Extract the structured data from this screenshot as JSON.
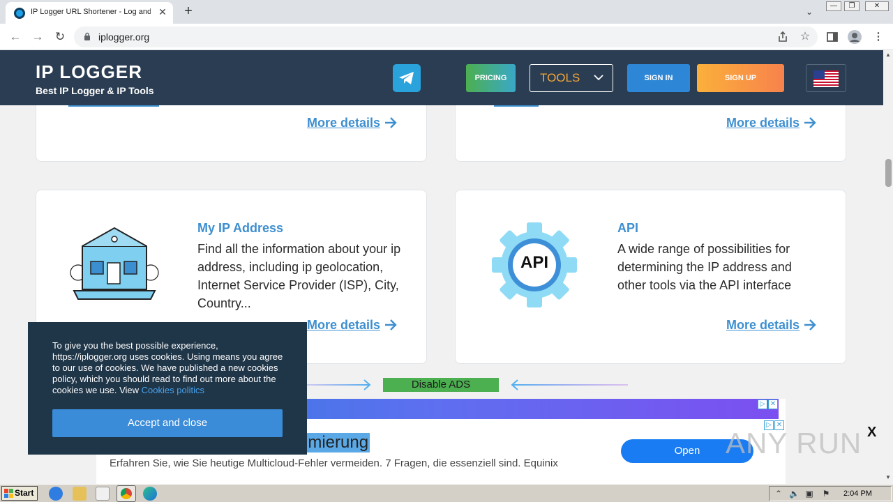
{
  "browser": {
    "tab_title": "IP Logger URL Shortener - Log and T",
    "tab_close": "✕",
    "new_tab": "+",
    "url": "iplogger.org",
    "back": "←",
    "forward": "→",
    "reload": "↻",
    "tab_search": "⌄",
    "window_controls": [
      "—",
      "❐",
      "✕"
    ],
    "menu": "⋮"
  },
  "site": {
    "logo": "IP LOGGER",
    "tagline": "Best IP Logger & IP Tools",
    "nav": {
      "pricing": "PRICING",
      "tools": "TOOLS",
      "sign_in": "SIGN IN",
      "sign_up": "SIGN UP"
    }
  },
  "cards": {
    "top_left": {
      "more": "More details"
    },
    "top_right": {
      "more": "More details"
    },
    "my_ip": {
      "title": "My IP Address",
      "desc": "Find all the information about your ip address, including ip geolocation, Internet Service Provider (ISP), City, Country...",
      "more": "More details"
    },
    "api": {
      "title": "API",
      "icon_text": "API",
      "desc": "A wide range of possibilities for determining the IP address and other tools via the API interface",
      "more": "More details"
    }
  },
  "ads": {
    "disable_label": "Disable ADS",
    "headline": "imierung",
    "text": "Erfahren Sie, wie Sie heutige Multicloud-Fehler vermeiden. 7 Fragen, die essenziell sind. Equinix",
    "open_label": "Open",
    "close_x": "X",
    "adchoice_play": "▷",
    "adchoice_close": "✕"
  },
  "cookie": {
    "text": "To give you the best possible experience, https://iplogger.org uses cookies. Using means you agree to our use of cookies. We have published a new cookies policy, which you should read to find out more about the cookies we use. View ",
    "link": "Cookies politics",
    "accept": "Accept and close"
  },
  "watermark": "ANY RUN",
  "taskbar": {
    "start": "Start",
    "clock": "2:04 PM"
  },
  "colors": {
    "header_bg": "#2a3d52",
    "link_blue": "#3e8fd0",
    "tools_orange": "#f4a63a",
    "cookie_bg": "#1f3548"
  }
}
